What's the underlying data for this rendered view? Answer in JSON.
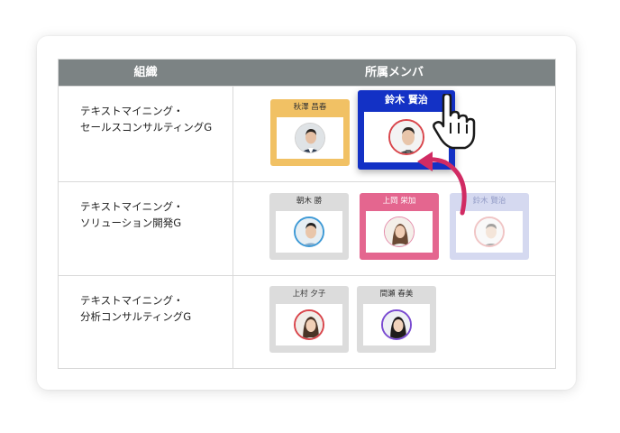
{
  "table": {
    "header_org": "組織",
    "header_members": "所属メンバ"
  },
  "rows": [
    {
      "org_line1": "テキストマイニング・",
      "org_line2": "セールスコンサルティングG",
      "members": [
        {
          "name": "秋澤 昌春"
        }
      ]
    },
    {
      "org_line1": "テキストマイニング・",
      "org_line2": "ソリューション開発G",
      "members": [
        {
          "name": "朝木 勝"
        },
        {
          "name": "上岡 栄加"
        },
        {
          "name": "鈴木 賢治"
        }
      ]
    },
    {
      "org_line1": "テキストマイニング・",
      "org_line2": "分析コンサルティングG",
      "members": [
        {
          "name": "上村 夕子"
        },
        {
          "name": "間瀬 春美"
        }
      ]
    }
  ],
  "dragging": {
    "name": "鈴木 賢治"
  },
  "colors": {
    "header_bg": "#7c8384",
    "yellow_card": "#f1c164",
    "pink_card": "#e4668f",
    "blue_card": "#1331c5",
    "gray_card": "#dcdcdc",
    "arrow": "#d12b63"
  },
  "icons": {
    "cursor": "pointer-hand-icon",
    "move": "curved-arrow-icon"
  }
}
